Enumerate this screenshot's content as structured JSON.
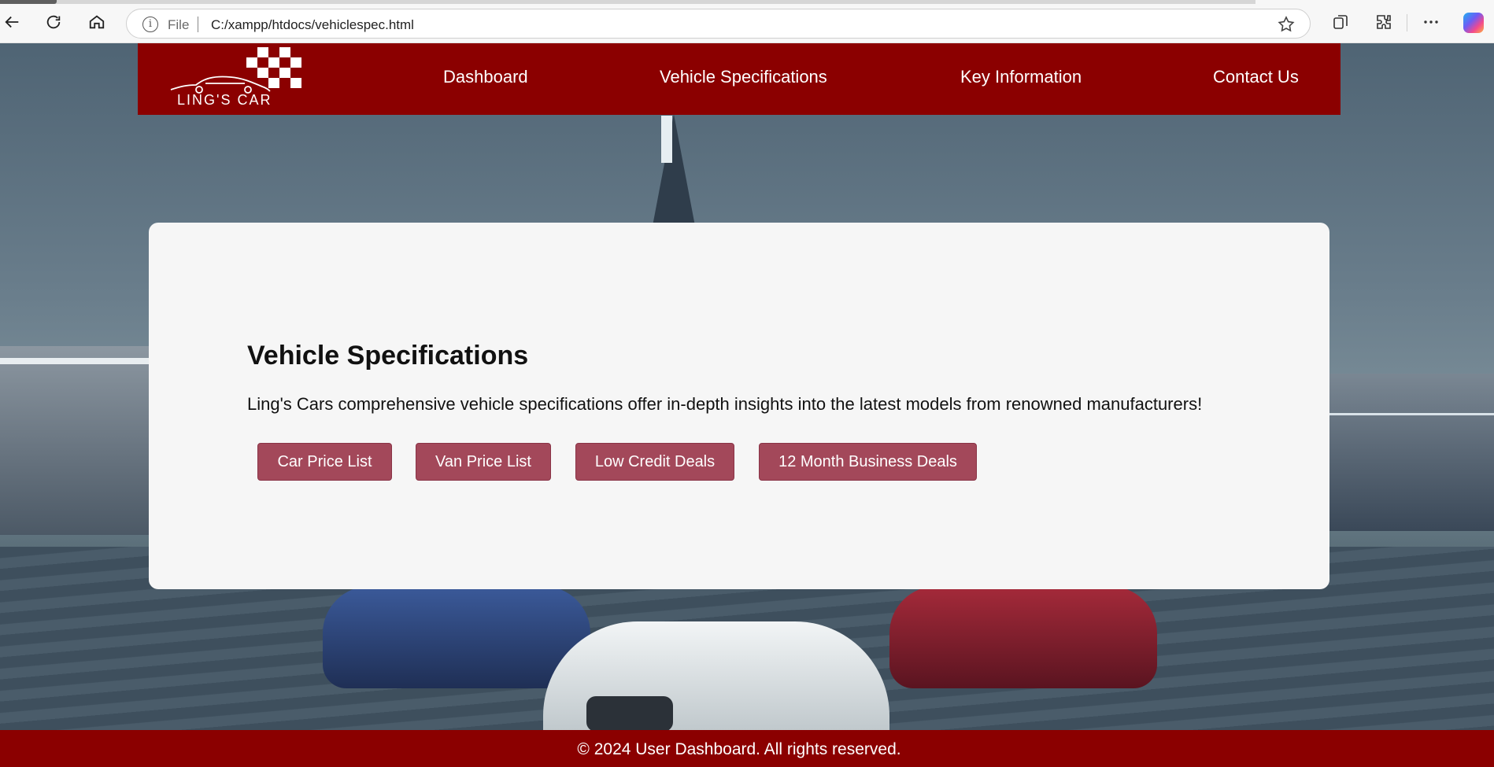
{
  "browser": {
    "file_label": "File",
    "url": "C:/xampp/htdocs/vehiclespec.html"
  },
  "header": {
    "logo_text": "LING'S CAR",
    "nav": [
      {
        "label": "Dashboard"
      },
      {
        "label": "Vehicle Specifications"
      },
      {
        "label": "Key Information"
      },
      {
        "label": "Contact Us"
      }
    ]
  },
  "main": {
    "title": "Vehicle Specifications",
    "description": "Ling's Cars comprehensive vehicle specifications offer in-depth insights into the latest models from renowned manufacturers!",
    "buttons": [
      {
        "label": "Car Price List"
      },
      {
        "label": "Van Price List"
      },
      {
        "label": "Low Credit Deals"
      },
      {
        "label": "12 Month Business Deals"
      }
    ]
  },
  "footer": {
    "text": "© 2024 User Dashboard. All rights reserved."
  },
  "colors": {
    "header_bg": "#8b0000",
    "button_bg": "#a3485a",
    "card_bg": "#f6f6f6"
  }
}
